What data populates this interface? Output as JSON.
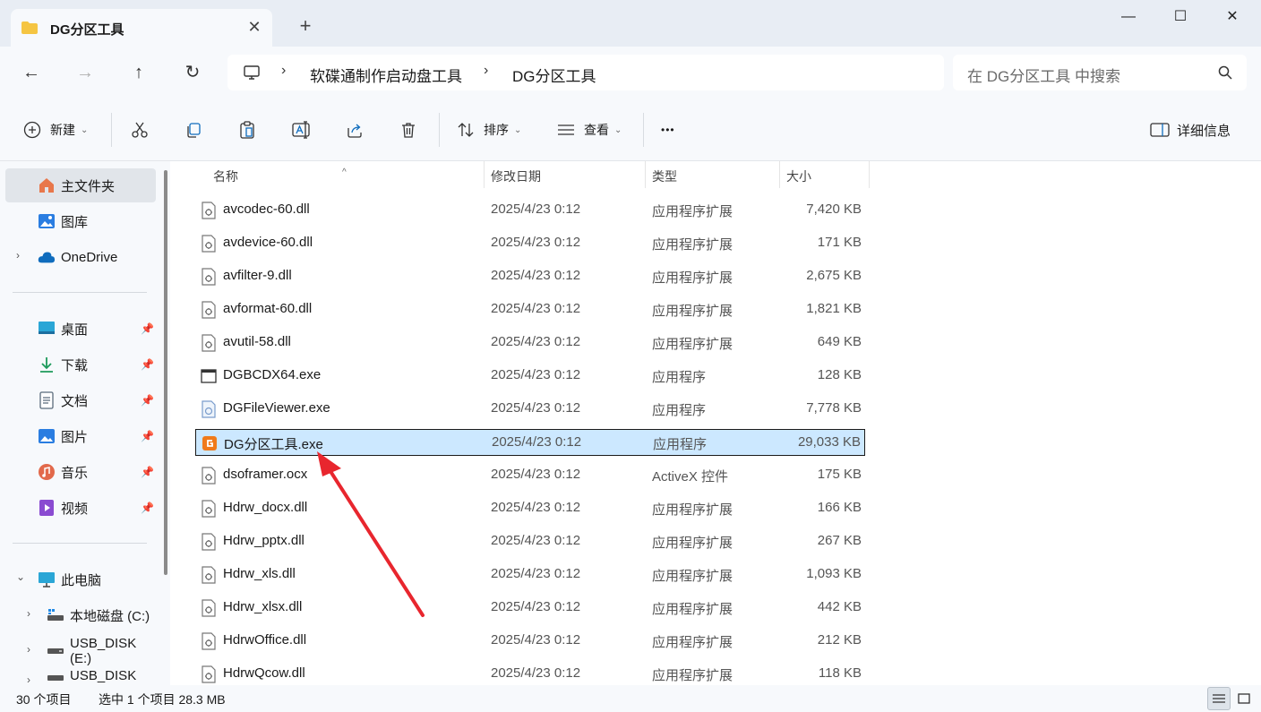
{
  "window": {
    "tab_title": "DG分区工具",
    "tab_close": "✕",
    "new_tab": "+",
    "minimize": "—",
    "maximize": "☐",
    "close": "✕"
  },
  "nav": {
    "back": "←",
    "forward": "→",
    "up": "↑",
    "refresh": "↻"
  },
  "address": {
    "sep": "›",
    "crumbs": [
      "软碟通制作启动盘工具",
      "DG分区工具"
    ]
  },
  "search": {
    "placeholder": "在 DG分区工具 中搜索"
  },
  "toolbar": {
    "new_label": "新建",
    "sort_label": "排序",
    "view_label": "查看",
    "more": "•••",
    "details_label": "详细信息",
    "chevron": "⌄"
  },
  "sidebar": {
    "home": "主文件夹",
    "gallery": "图库",
    "onedrive": "OneDrive",
    "quick": [
      "桌面",
      "下载",
      "文档",
      "图片",
      "音乐",
      "视频"
    ],
    "pin": "📌",
    "thispc": "此电脑",
    "drives": [
      "本地磁盘 (C:)",
      "USB_DISK (E:)",
      "USB_DISK (F:)"
    ],
    "expand": "›",
    "expanded": "⌄"
  },
  "columns": {
    "name": "名称",
    "date": "修改日期",
    "type": "类型",
    "size": "大小"
  },
  "files": [
    {
      "name": "avcodec-60.dll",
      "date": "2025/4/23 0:12",
      "type": "应用程序扩展",
      "size": "7,420 KB",
      "icon": "dll-icon"
    },
    {
      "name": "avdevice-60.dll",
      "date": "2025/4/23 0:12",
      "type": "应用程序扩展",
      "size": "171 KB",
      "icon": "dll-icon"
    },
    {
      "name": "avfilter-9.dll",
      "date": "2025/4/23 0:12",
      "type": "应用程序扩展",
      "size": "2,675 KB",
      "icon": "dll-icon"
    },
    {
      "name": "avformat-60.dll",
      "date": "2025/4/23 0:12",
      "type": "应用程序扩展",
      "size": "1,821 KB",
      "icon": "dll-icon"
    },
    {
      "name": "avutil-58.dll",
      "date": "2025/4/23 0:12",
      "type": "应用程序扩展",
      "size": "649 KB",
      "icon": "dll-icon"
    },
    {
      "name": "DGBCDX64.exe",
      "date": "2025/4/23 0:12",
      "type": "应用程序",
      "size": "128 KB",
      "icon": "window-exe-icon"
    },
    {
      "name": "DGFileViewer.exe",
      "date": "2025/4/23 0:12",
      "type": "应用程序",
      "size": "7,778 KB",
      "icon": "viewer-exe-icon"
    },
    {
      "name": "DG分区工具.exe",
      "date": "2025/4/23 0:12",
      "type": "应用程序",
      "size": "29,033 KB",
      "icon": "dg-app-icon"
    },
    {
      "name": "dsoframer.ocx",
      "date": "2025/4/23 0:12",
      "type": "ActiveX 控件",
      "size": "175 KB",
      "icon": "dll-icon"
    },
    {
      "name": "Hdrw_docx.dll",
      "date": "2025/4/23 0:12",
      "type": "应用程序扩展",
      "size": "166 KB",
      "icon": "dll-icon"
    },
    {
      "name": "Hdrw_pptx.dll",
      "date": "2025/4/23 0:12",
      "type": "应用程序扩展",
      "size": "267 KB",
      "icon": "dll-icon"
    },
    {
      "name": "Hdrw_xls.dll",
      "date": "2025/4/23 0:12",
      "type": "应用程序扩展",
      "size": "1,093 KB",
      "icon": "dll-icon"
    },
    {
      "name": "Hdrw_xlsx.dll",
      "date": "2025/4/23 0:12",
      "type": "应用程序扩展",
      "size": "442 KB",
      "icon": "dll-icon"
    },
    {
      "name": "HdrwOffice.dll",
      "date": "2025/4/23 0:12",
      "type": "应用程序扩展",
      "size": "212 KB",
      "icon": "dll-icon"
    },
    {
      "name": "HdrwQcow.dll",
      "date": "2025/4/23 0:12",
      "type": "应用程序扩展",
      "size": "118 KB",
      "icon": "dll-icon"
    }
  ],
  "selected_file": "DG分区工具.exe",
  "status": {
    "count": "30 个项目",
    "selection": "选中 1 个项目  28.3 MB"
  },
  "colors": {
    "accent": "#cce8ff",
    "annotation_arrow": "#e8262e",
    "folder": "#f5c542",
    "onedrive": "#0f6cbd"
  }
}
